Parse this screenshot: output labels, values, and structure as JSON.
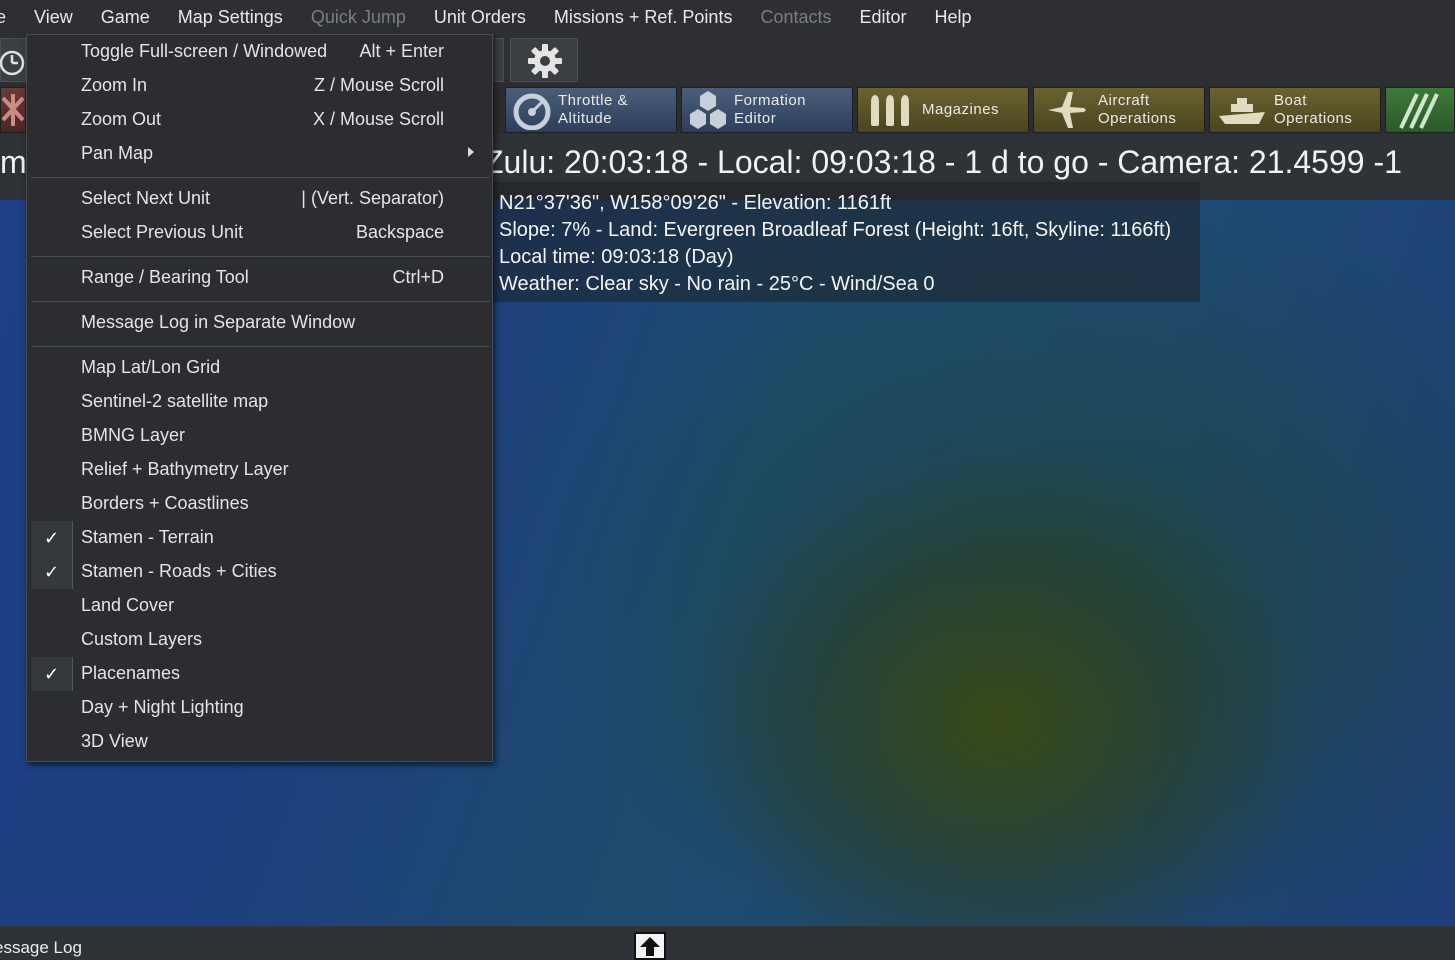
{
  "menubar": {
    "items": [
      {
        "label": "e",
        "disabled": false
      },
      {
        "label": "View",
        "disabled": false
      },
      {
        "label": "Game",
        "disabled": false
      },
      {
        "label": "Map Settings",
        "disabled": false
      },
      {
        "label": "Quick Jump",
        "disabled": true
      },
      {
        "label": "Unit Orders",
        "disabled": false
      },
      {
        "label": "Missions + Ref. Points",
        "disabled": false
      },
      {
        "label": "Contacts",
        "disabled": true
      },
      {
        "label": "Editor",
        "disabled": false
      },
      {
        "label": "Help",
        "disabled": false
      }
    ]
  },
  "toolbar2": {
    "throttle": "Throttle &\nAltitude",
    "formation": "Formation\nEditor",
    "magazines": "Magazines",
    "aircraft": "Aircraft\nOperations",
    "boat": "Boat\nOperations"
  },
  "status": {
    "stub": "m",
    "zulu_line": "Zulu: 20:03:18 - Local: 09:03:18 - 1 d to go -  Camera: 21.4599 -1"
  },
  "info": {
    "coords": "N21°37'36\", W158°09'26\" - Elevation: 1161ft",
    "slope": "Slope: 7%  - Land: Evergreen Broadleaf Forest (Height: 16ft, Skyline: 1166ft)",
    "local_time": "Local time: 09:03:18 (Day)",
    "weather": "Weather: Clear sky - No rain - 25°C - Wind/Sea 0"
  },
  "view_menu": {
    "toggle_fullscreen": {
      "label": "Toggle Full-screen / Windowed",
      "shortcut": "Alt + Enter"
    },
    "zoom_in": {
      "label": "Zoom In",
      "shortcut": "Z / Mouse Scroll"
    },
    "zoom_out": {
      "label": "Zoom Out",
      "shortcut": "X / Mouse Scroll"
    },
    "pan_map": {
      "label": "Pan Map"
    },
    "select_next": {
      "label": "Select Next Unit",
      "shortcut": "| (Vert. Separator)"
    },
    "select_prev": {
      "label": "Select Previous Unit",
      "shortcut": "Backspace"
    },
    "range_bearing": {
      "label": "Range / Bearing Tool",
      "shortcut": "Ctrl+D"
    },
    "message_log": {
      "label": "Message Log in Separate Window"
    },
    "latlon_grid": {
      "label": "Map Lat/Lon Grid"
    },
    "sentinel": {
      "label": "Sentinel-2 satellite map"
    },
    "bmng": {
      "label": "BMNG Layer"
    },
    "relief": {
      "label": "Relief + Bathymetry Layer"
    },
    "borders": {
      "label": "Borders + Coastlines"
    },
    "stamen_terrain": {
      "label": "Stamen - Terrain",
      "checked": true
    },
    "stamen_roads": {
      "label": "Stamen - Roads + Cities",
      "checked": true
    },
    "land_cover": {
      "label": "Land Cover"
    },
    "custom_layers": {
      "label": "Custom Layers"
    },
    "placenames": {
      "label": "Placenames",
      "checked": true
    },
    "day_night": {
      "label": "Day + Night Lighting"
    },
    "view_3d": {
      "label": "3D View"
    },
    "check_glyph": "✓"
  },
  "message_bar": {
    "label": "essage Log"
  }
}
